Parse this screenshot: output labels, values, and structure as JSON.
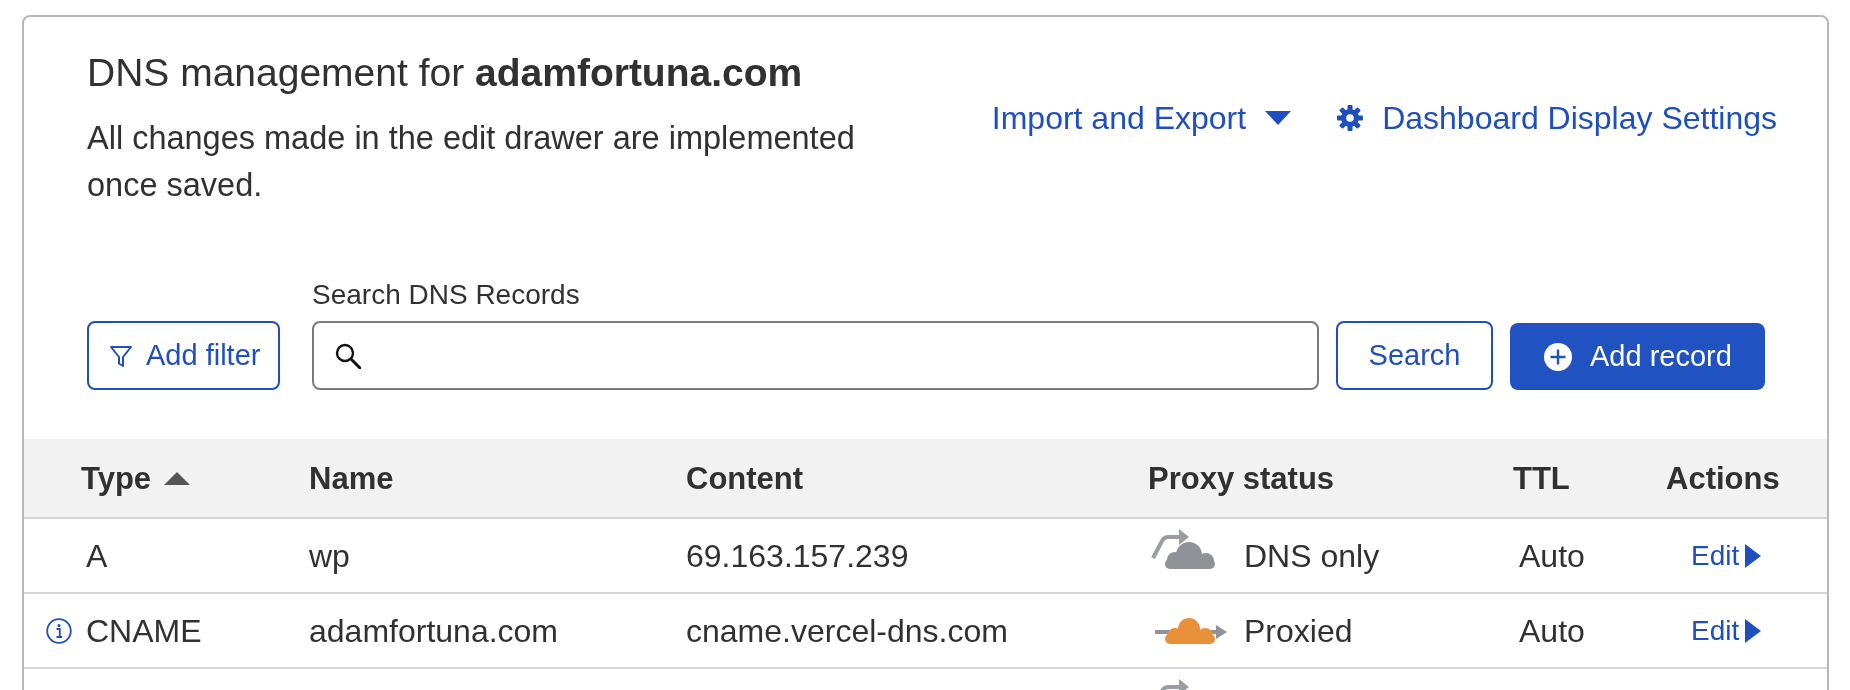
{
  "header": {
    "title": "DNS management for **adamfortuna.com**",
    "description": "All changes made in the edit drawer are implemented once saved."
  },
  "links": [
    {
      "kind": "dropdown",
      "label": "Import and Export"
    },
    {
      "kind": "settings",
      "label": "Dashboard Display Settings"
    }
  ],
  "toolbar": {
    "filter_button": "Add filter",
    "search_label": "Search DNS Records",
    "search_button": "Search",
    "add_button": "Add record"
  },
  "table": {
    "columns": [
      {
        "label": "Type",
        "sorted": true
      },
      {
        "label": "Name",
        "sorted": false
      },
      {
        "label": "Content",
        "sorted": false
      },
      {
        "label": "Proxy status",
        "sorted": false
      },
      {
        "label": "TTL",
        "sorted": false
      },
      {
        "label": "Actions",
        "sorted": false
      }
    ],
    "rows": [
      {
        "type": "A",
        "info": false,
        "name": "wp",
        "content": "69.163.157.239",
        "proxied": false,
        "proxy_status": "DNS only",
        "ttl": "Auto",
        "action": "Edit"
      },
      {
        "type": "CNAME",
        "info": true,
        "name": "adamfortuna.com",
        "content": "cname.vercel-dns.com",
        "proxied": true,
        "proxy_status": "Proxied",
        "ttl": "Auto",
        "action": "Edit"
      },
      {
        "proxied": false
      }
    ]
  }
}
